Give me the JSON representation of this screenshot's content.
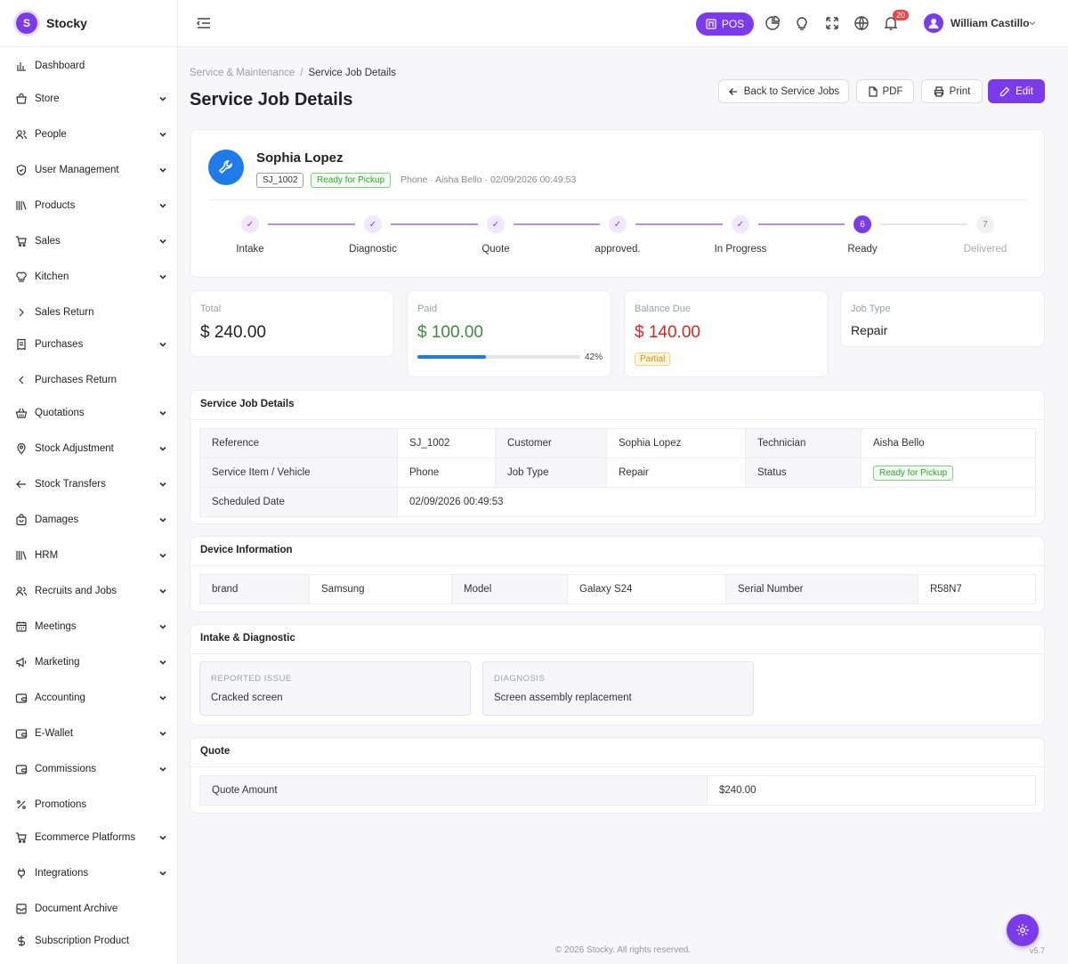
{
  "brand": {
    "logo_letter": "S",
    "name": "Stocky"
  },
  "sidebar": {
    "items": [
      {
        "label": "Dashboard",
        "icon": "bar-chart-icon",
        "expandable": false
      },
      {
        "label": "Store",
        "icon": "store-icon",
        "expandable": true
      },
      {
        "label": "People",
        "icon": "users-icon",
        "expandable": true
      },
      {
        "label": "User Management",
        "icon": "shield-icon",
        "expandable": true
      },
      {
        "label": "Products",
        "icon": "library-icon",
        "expandable": true
      },
      {
        "label": "Sales",
        "icon": "cart-icon",
        "expandable": true
      },
      {
        "label": "Kitchen",
        "icon": "chef-hat-icon",
        "expandable": true
      },
      {
        "label": "Sales Return",
        "icon": "chevron-right-icon",
        "expandable": false
      },
      {
        "label": "Purchases",
        "icon": "receipt-icon",
        "expandable": true
      },
      {
        "label": "Purchases Return",
        "icon": "chevron-left-icon",
        "expandable": false
      },
      {
        "label": "Quotations",
        "icon": "basket-icon",
        "expandable": true
      },
      {
        "label": "Stock Adjustment",
        "icon": "map-pin-icon",
        "expandable": true
      },
      {
        "label": "Stock Transfers",
        "icon": "arrow-left-icon",
        "expandable": true
      },
      {
        "label": "Damages",
        "icon": "bag-icon",
        "expandable": true
      },
      {
        "label": "HRM",
        "icon": "library-icon",
        "expandable": true
      },
      {
        "label": "Recruits and Jobs",
        "icon": "users-icon",
        "expandable": true
      },
      {
        "label": "Meetings",
        "icon": "calendar-icon",
        "expandable": true
      },
      {
        "label": "Marketing",
        "icon": "megaphone-icon",
        "expandable": true
      },
      {
        "label": "Accounting",
        "icon": "wallet-icon",
        "expandable": true
      },
      {
        "label": "E-Wallet",
        "icon": "wallet-icon",
        "expandable": true
      },
      {
        "label": "Commissions",
        "icon": "wallet-icon",
        "expandable": true
      },
      {
        "label": "Promotions",
        "icon": "percent-icon",
        "expandable": false
      },
      {
        "label": "Ecommerce Platforms",
        "icon": "cart-icon",
        "expandable": true
      },
      {
        "label": "Integrations",
        "icon": "plug-icon",
        "expandable": true
      },
      {
        "label": "Document Archive",
        "icon": "archive-icon",
        "expandable": false
      },
      {
        "label": "Subscription Product",
        "icon": "dollar-icon",
        "expandable": false
      }
    ]
  },
  "header": {
    "pos_label": "POS",
    "notification_count": "20",
    "user_name": "William Castillo"
  },
  "breadcrumb": {
    "parent": "Service & Maintenance",
    "separator": "/",
    "current": "Service Job Details"
  },
  "page": {
    "title": "Service Job Details"
  },
  "actions": {
    "back": "Back to Service Jobs",
    "pdf": "PDF",
    "print": "Print",
    "edit": "Edit"
  },
  "job": {
    "customer_name": "Sophia Lopez",
    "reference": "SJ_1002",
    "status": "Ready for Pickup",
    "meta": "Phone · Aisha Bello · 02/09/2026 00:49:53"
  },
  "steps": [
    {
      "label": "Intake",
      "state": "done",
      "marker": "✓"
    },
    {
      "label": "Diagnostic",
      "state": "done",
      "marker": "✓"
    },
    {
      "label": "Quote",
      "state": "done",
      "marker": "✓"
    },
    {
      "label": "approved.",
      "state": "done",
      "marker": "✓"
    },
    {
      "label": "In Progress",
      "state": "done",
      "marker": "✓"
    },
    {
      "label": "Ready",
      "state": "active",
      "marker": "6"
    },
    {
      "label": "Delivered",
      "state": "pending",
      "marker": "7"
    }
  ],
  "stats": {
    "total": {
      "label": "Total",
      "value": "$ 240.00"
    },
    "paid": {
      "label": "Paid",
      "value": "$ 100.00",
      "progress": 0.42,
      "progress_label": "42%"
    },
    "balance": {
      "label": "Balance Due",
      "value": "$ 140.00",
      "tag": "Partial"
    },
    "job_type": {
      "label": "Job Type",
      "value": "Repair"
    }
  },
  "details": {
    "title": "Service Job Details",
    "reference_label": "Reference",
    "reference": "SJ_1002",
    "customer_label": "Customer",
    "customer": "Sophia Lopez",
    "technician_label": "Technician",
    "technician": "Aisha Bello",
    "item_label": "Service Item / Vehicle",
    "item": "Phone",
    "jobtype_label": "Job Type",
    "jobtype": "Repair",
    "status_label": "Status",
    "status": "Ready for Pickup",
    "scheduled_label": "Scheduled Date",
    "scheduled": "02/09/2026 00:49:53"
  },
  "device": {
    "title": "Device Information",
    "brand_label": "brand",
    "brand": "Samsung",
    "model_label": "Model",
    "model": "Galaxy S24",
    "serial_label": "Serial Number",
    "serial": "R58N7"
  },
  "intake": {
    "title": "Intake & Diagnostic",
    "issue_label": "REPORTED ISSUE",
    "issue": "Cracked screen",
    "diagnosis_label": "DIAGNOSIS",
    "diagnosis": "Screen assembly replacement"
  },
  "quote": {
    "title": "Quote",
    "amount_label": "Quote Amount",
    "amount": "$240.00"
  },
  "footer": {
    "copyright": "© 2026 Stocky. All rights reserved.",
    "version": "v5.7"
  },
  "colors": {
    "accent": "#7c3aed",
    "info": "#1e7be9",
    "success": "#35a335",
    "danger": "#dc2626",
    "warning": "#c99415"
  }
}
